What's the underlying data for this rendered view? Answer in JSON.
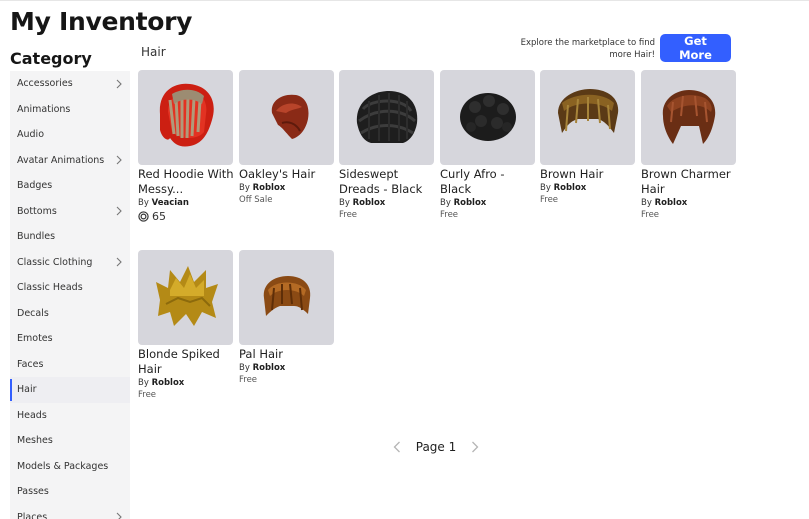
{
  "page": {
    "title": "My Inventory",
    "category_heading": "Category",
    "section_label": "Hair"
  },
  "sidebar": {
    "items": [
      {
        "label": "Accessories",
        "has_chevron": true
      },
      {
        "label": "Animations",
        "has_chevron": false
      },
      {
        "label": "Audio",
        "has_chevron": false
      },
      {
        "label": "Avatar Animations",
        "has_chevron": true
      },
      {
        "label": "Badges",
        "has_chevron": false
      },
      {
        "label": "Bottoms",
        "has_chevron": true
      },
      {
        "label": "Bundles",
        "has_chevron": false
      },
      {
        "label": "Classic Clothing",
        "has_chevron": true
      },
      {
        "label": "Classic Heads",
        "has_chevron": false
      },
      {
        "label": "Decals",
        "has_chevron": false
      },
      {
        "label": "Emotes",
        "has_chevron": false
      },
      {
        "label": "Faces",
        "has_chevron": false
      },
      {
        "label": "Hair",
        "has_chevron": false,
        "active": true
      },
      {
        "label": "Heads",
        "has_chevron": false
      },
      {
        "label": "Meshes",
        "has_chevron": false
      },
      {
        "label": "Models & Packages",
        "has_chevron": false
      },
      {
        "label": "Passes",
        "has_chevron": false
      },
      {
        "label": "Places",
        "has_chevron": true
      }
    ]
  },
  "marketplace_prompt": {
    "text": "Explore the marketplace to find more Hair!",
    "button_label": "Get More"
  },
  "items": [
    {
      "name": "Red Hoodie With Messy...",
      "by_prefix": "By",
      "creator": "Veacian",
      "price": "65",
      "price_is_robux": true,
      "icon": "red-hoodie-hair-icon"
    },
    {
      "name": "Oakley's Hair",
      "by_prefix": "By",
      "creator": "Roblox",
      "price": "Off Sale",
      "price_is_robux": false,
      "icon": "red-hair-icon"
    },
    {
      "name": "Sideswept Dreads - Black",
      "by_prefix": "By",
      "creator": "Roblox",
      "price": "Free",
      "price_is_robux": false,
      "icon": "black-dreads-icon"
    },
    {
      "name": "Curly Afro - Black",
      "by_prefix": "By",
      "creator": "Roblox",
      "price": "Free",
      "price_is_robux": false,
      "icon": "black-afro-icon"
    },
    {
      "name": "Brown Hair",
      "by_prefix": "By",
      "creator": "Roblox",
      "price": "Free",
      "price_is_robux": false,
      "icon": "brown-hair-icon"
    },
    {
      "name": "Brown Charmer Hair",
      "by_prefix": "By",
      "creator": "Roblox",
      "price": "Free",
      "price_is_robux": false,
      "icon": "brown-charmer-hair-icon"
    },
    {
      "name": "Blonde Spiked Hair",
      "by_prefix": "By",
      "creator": "Roblox",
      "price": "Free",
      "price_is_robux": false,
      "icon": "blonde-spiked-hair-icon"
    },
    {
      "name": "Pal Hair",
      "by_prefix": "By",
      "creator": "Roblox",
      "price": "Free",
      "price_is_robux": false,
      "icon": "pal-hair-icon"
    }
  ],
  "pagination": {
    "label": "Page 1"
  },
  "colors": {
    "accent": "#335fff",
    "thumb_bg": "#d6d6dc",
    "sidebar_bg": "#f4f4f5"
  }
}
